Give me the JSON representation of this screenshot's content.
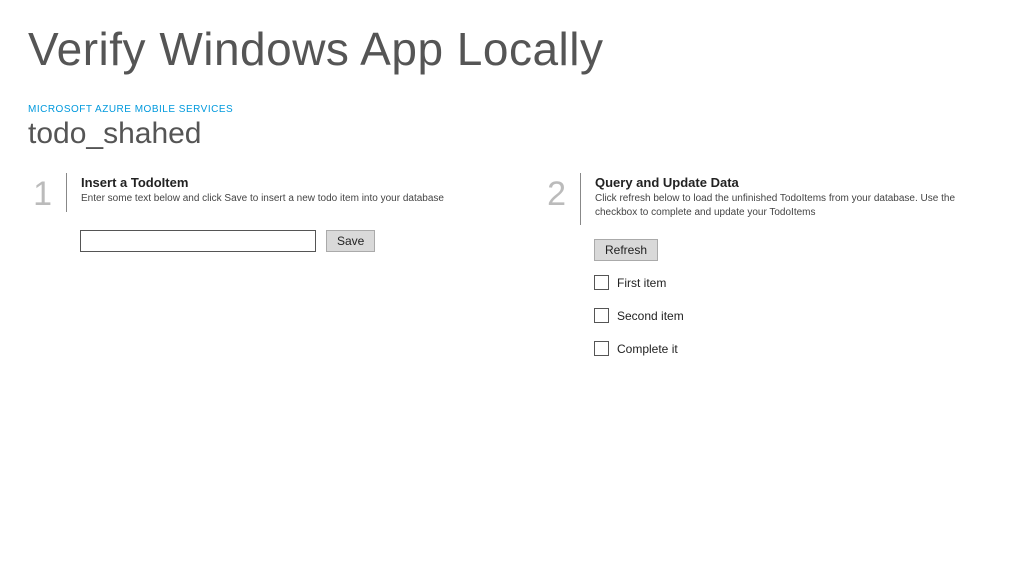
{
  "page_title": "Verify Windows App Locally",
  "subtitle": {
    "service_label": "MICROSOFT AZURE MOBILE SERVICES",
    "service_name": "todo_shahed"
  },
  "sections": [
    {
      "number": "1",
      "heading": "Insert a TodoItem",
      "description": "Enter some text below and click Save to insert a new todo item into your database",
      "save_label": "Save",
      "input_value": ""
    },
    {
      "number": "2",
      "heading": "Query and Update Data",
      "description": "Click refresh below to load the unfinished TodoItems from your database. Use the checkbox to complete and update your TodoItems",
      "refresh_label": "Refresh",
      "items": [
        {
          "label": "First item",
          "checked": false
        },
        {
          "label": "Second item",
          "checked": false
        },
        {
          "label": "Complete it",
          "checked": false
        }
      ]
    }
  ]
}
